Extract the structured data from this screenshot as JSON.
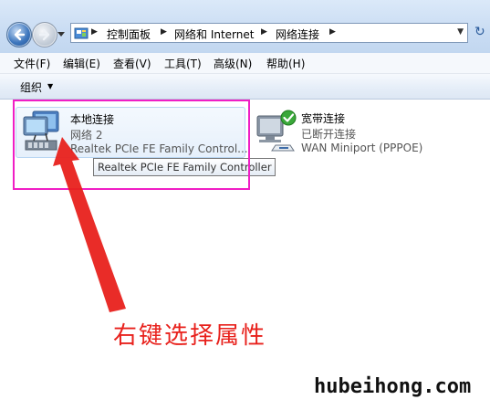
{
  "address_bar": {
    "breadcrumbs": [
      "控制面板",
      "网络和 Internet",
      "网络连接"
    ]
  },
  "menu": {
    "items": [
      "文件(F)",
      "编辑(E)",
      "查看(V)",
      "工具(T)",
      "高级(N)",
      "帮助(H)"
    ]
  },
  "command_bar": {
    "organize_label": "组织"
  },
  "connections": [
    {
      "name": "本地连接",
      "status": "网络  2",
      "device": "Realtek PCIe FE Family Control..."
    },
    {
      "name": "宽带连接",
      "status": "已断开连接",
      "device": "WAN Miniport (PPPOE)"
    }
  ],
  "tooltip": {
    "text": "Realtek PCIe FE Family Controller"
  },
  "annotation": {
    "text": "右键选择属性",
    "color": "#e8211c",
    "highlight_color": "#f01ec5"
  },
  "watermark": {
    "text": "hubeihong.com"
  }
}
